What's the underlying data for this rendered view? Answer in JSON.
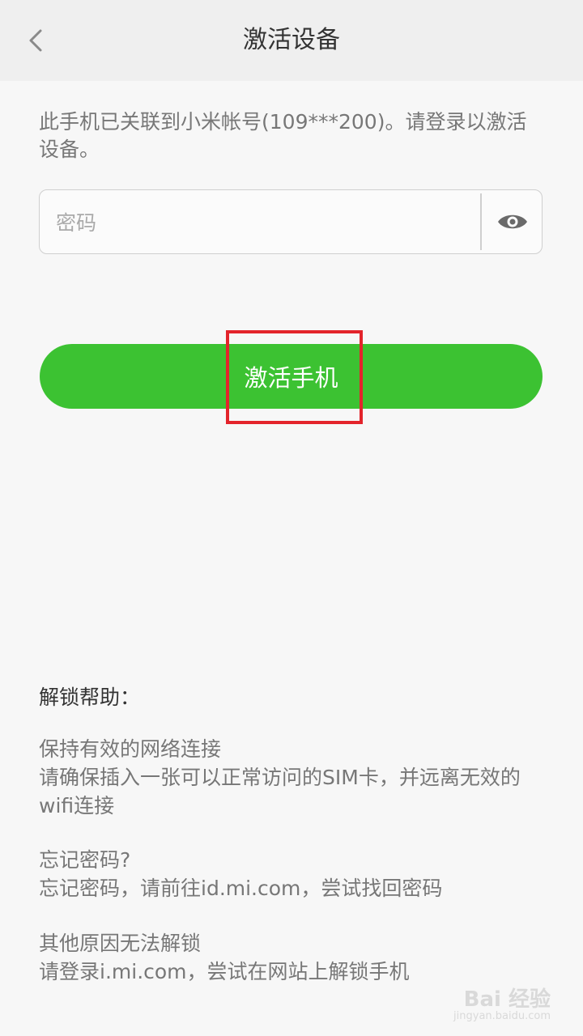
{
  "header": {
    "title": "激活设备",
    "back_icon": "chevron-left-icon"
  },
  "notice": "此手机已关联到小米帐号(109***200)。请登录以激活设备。",
  "password": {
    "placeholder": "密码",
    "value": "",
    "toggle_icon": "eye-icon"
  },
  "activate_button": {
    "label": "激活手机",
    "color": "#3cc232",
    "highlight_color": "#e3242b"
  },
  "help": {
    "title": "解锁帮助：",
    "items": [
      {
        "heading": "保持有效的网络连接",
        "body": "请确保插入一张可以正常访问的SIM卡，并远离无效的wifi连接"
      },
      {
        "heading": "忘记密码?",
        "body": "忘记密码，请前往id.mi.com，尝试找回密码"
      },
      {
        "heading": "其他原因无法解锁",
        "body": "请登录i.mi.com，尝试在网站上解锁手机"
      }
    ]
  },
  "watermark": {
    "text": "Bai 经验",
    "sub": "jingyan.baidu.com"
  }
}
